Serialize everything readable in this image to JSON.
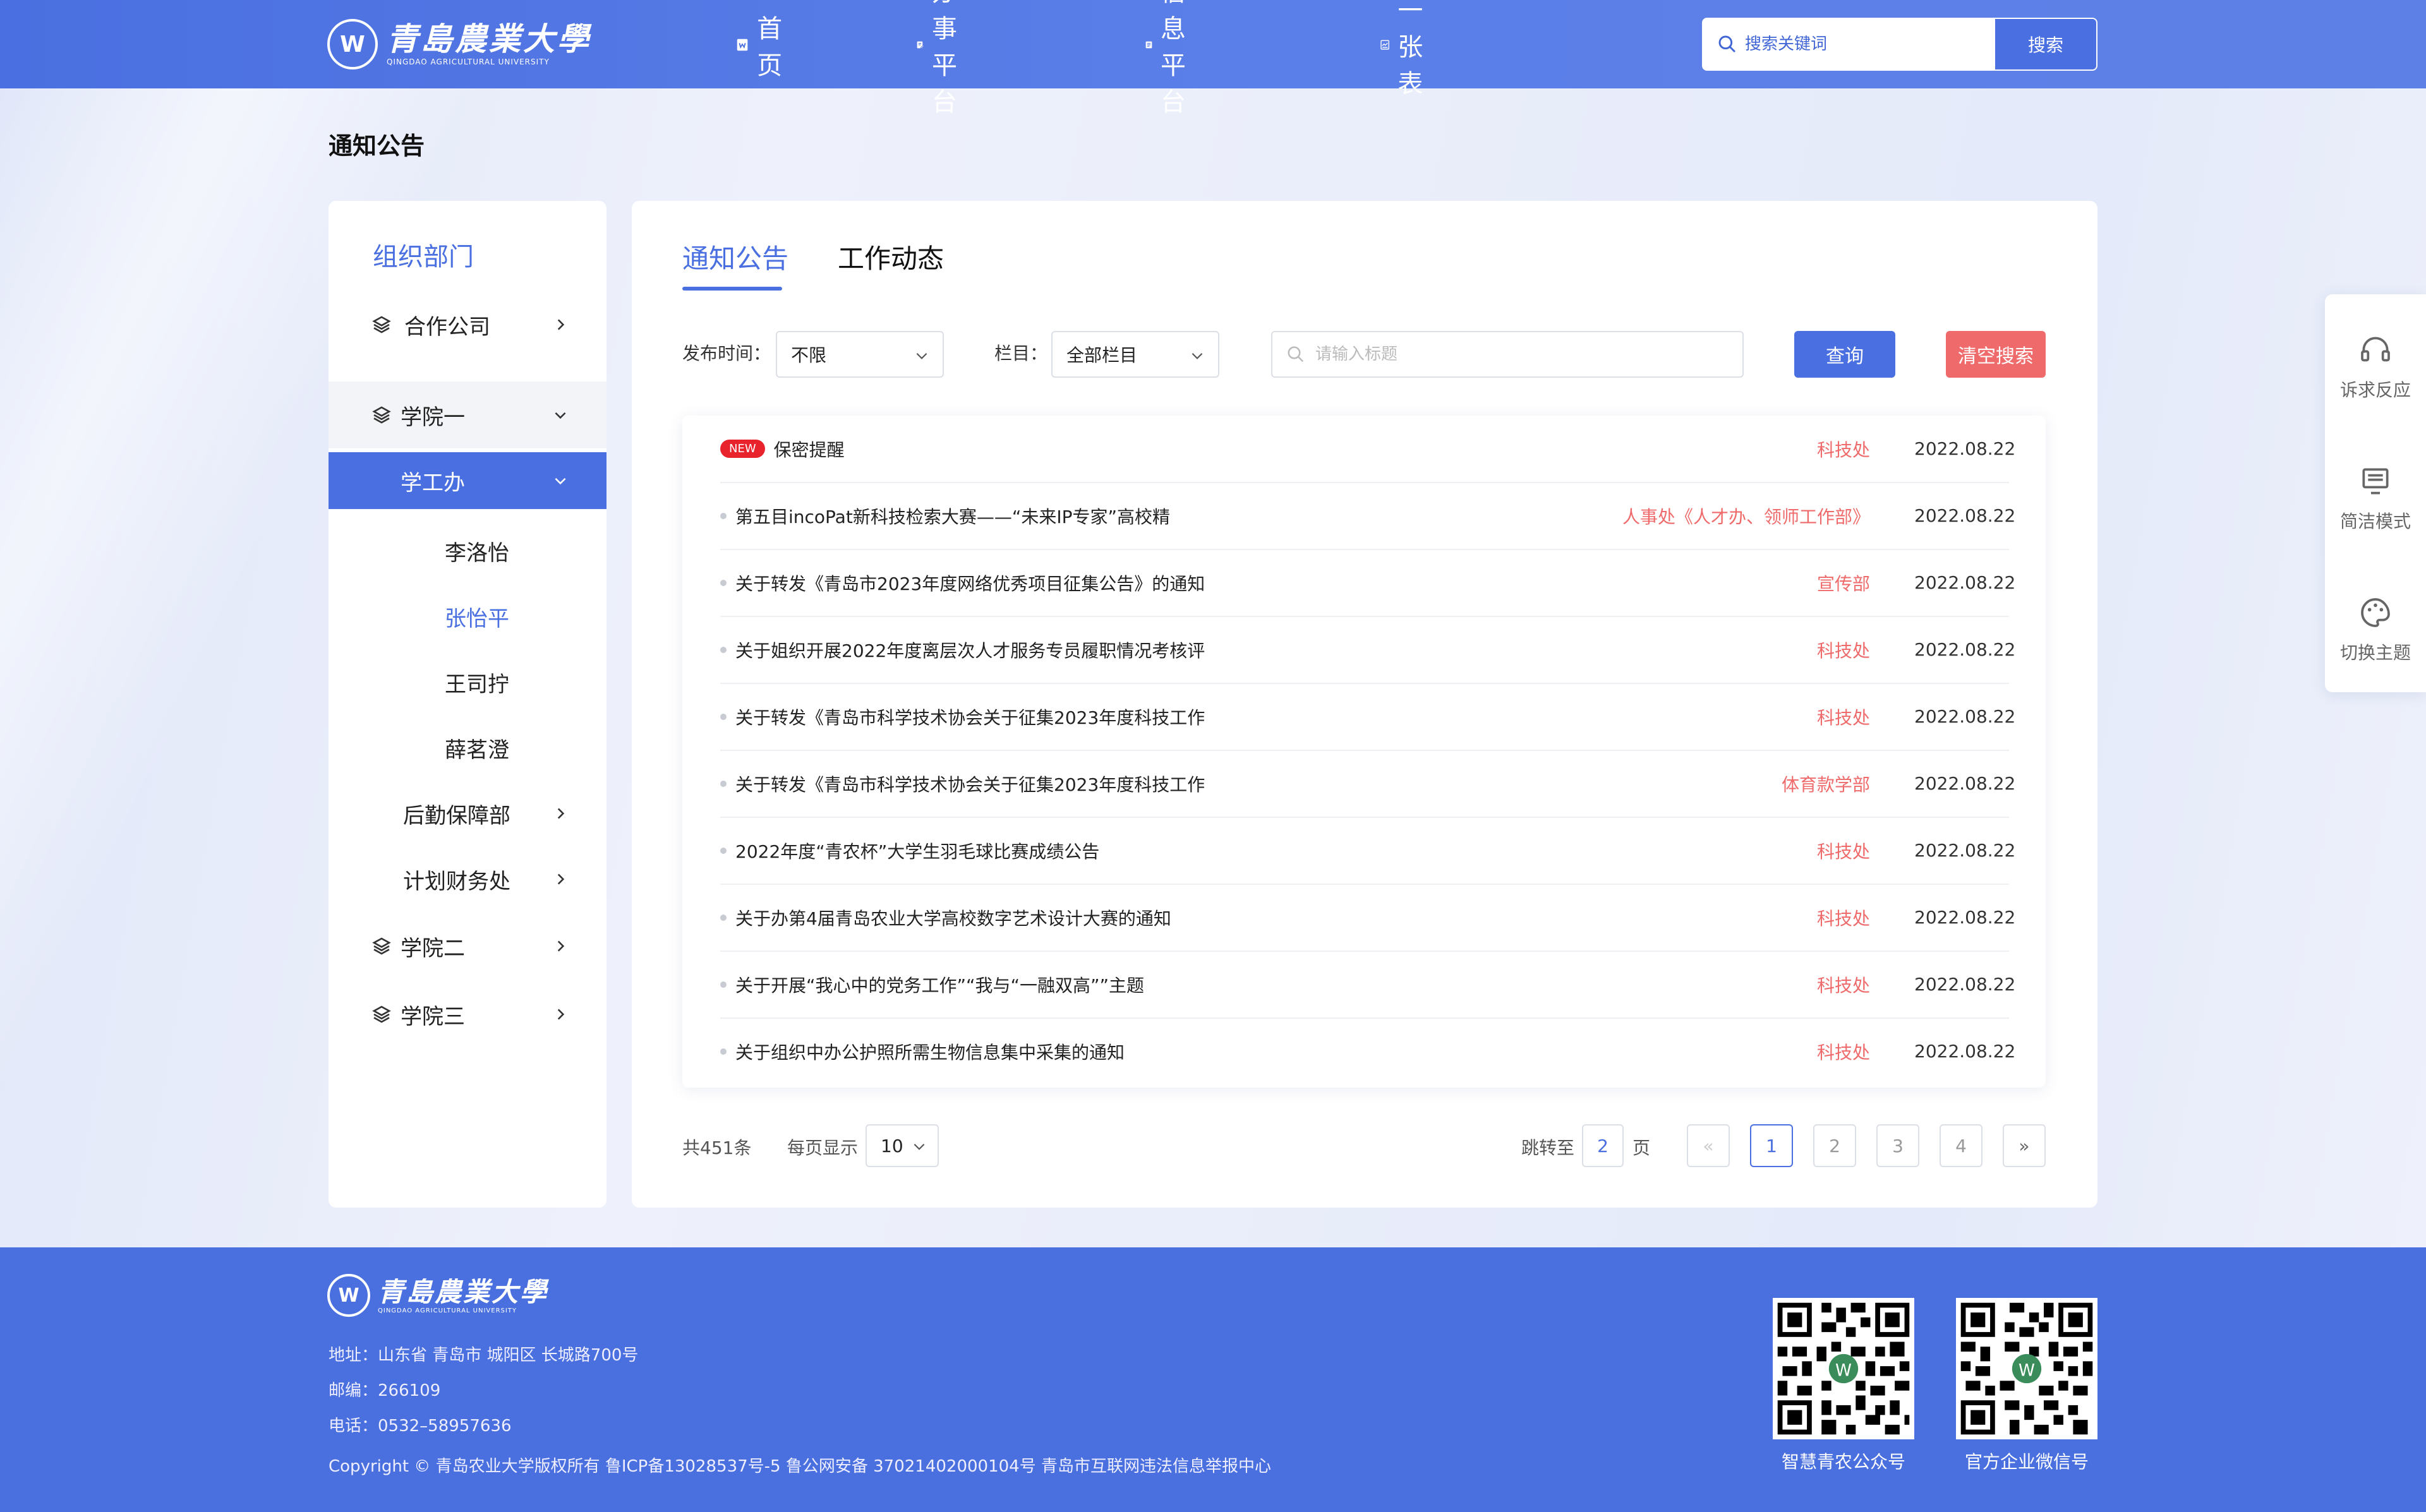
{
  "header": {
    "logo_cn": "青島農業大學",
    "logo_en": "QINGDAO AGRICULTURAL UNIVERSITY",
    "nav": [
      {
        "label": "首页",
        "icon": "home-doc-icon"
      },
      {
        "label": "办事平台",
        "icon": "edit-doc-icon"
      },
      {
        "label": "信息平台",
        "icon": "info-doc-icon"
      },
      {
        "label": "一张表",
        "icon": "chart-doc-icon"
      }
    ],
    "search_placeholder": "搜索关键词",
    "search_button": "搜索"
  },
  "page_title": "通知公告",
  "sidebar": {
    "heading": "组织部门",
    "items": [
      {
        "label": "合作公司"
      },
      {
        "label": "学院一"
      },
      {
        "label": "学工办"
      },
      {
        "label": "李洛怡"
      },
      {
        "label": "张怡平"
      },
      {
        "label": "王司拧"
      },
      {
        "label": "薛茗澄"
      },
      {
        "label": "后勤保障部"
      },
      {
        "label": "计划财务处"
      },
      {
        "label": "学院二"
      },
      {
        "label": "学院三"
      }
    ]
  },
  "tabs": [
    {
      "label": "通知公告",
      "active": true
    },
    {
      "label": "工作动态",
      "active": false
    }
  ],
  "filters": {
    "time_label": "发布时间：",
    "time_value": "不限",
    "column_label": "栏目：",
    "column_value": "全部栏目",
    "title_placeholder": "请输入标题",
    "query_button": "查询",
    "clear_button": "清空搜索"
  },
  "notices": [
    {
      "badge": "NEW",
      "title": "保密提醒",
      "dept": "科技处",
      "date": "2022.08.22"
    },
    {
      "title": "第五目incoPat新科技检索大赛——“未来IP专家”高校精",
      "dept": "人事处《人才办、领师工作部》",
      "date": "2022.08.22"
    },
    {
      "title": "关于转发《青岛市2023年度网络优秀项目征集公告》的通知",
      "dept": "宣传部",
      "date": "2022.08.22"
    },
    {
      "title": "关于姐织开展2022年度离层次人才服务专员履职情况考核评",
      "dept": "科技处",
      "date": "2022.08.22"
    },
    {
      "title": "关于转发《青岛市科学技术协会关于征集2023年度科技工作",
      "dept": "科技处",
      "date": "2022.08.22"
    },
    {
      "title": "关于转发《青岛市科学技术协会关于征集2023年度科技工作",
      "dept": "体育款学部",
      "date": "2022.08.22"
    },
    {
      "title": "2022年度“青农杯”大学生羽毛球比赛成绩公告",
      "dept": "科技处",
      "date": "2022.08.22"
    },
    {
      "title": "关于办第4届青岛农业大学高校数字艺术设计大赛的通知",
      "dept": "科技处",
      "date": "2022.08.22"
    },
    {
      "title": "关于开展“我心中的党务工作”“我与“一融双高””主题",
      "dept": "科技处",
      "date": "2022.08.22"
    },
    {
      "title": "关于组织中办公护照所需生物信息集中采集的通知",
      "dept": "科技处",
      "date": "2022.08.22"
    }
  ],
  "pagination": {
    "total": "共451条",
    "per_page_label": "每页显示",
    "per_page_value": "10",
    "jump_label": "跳转至",
    "jump_value": "2",
    "jump_unit": "页",
    "first": "«",
    "pages": [
      "1",
      "2",
      "3",
      "4"
    ],
    "current_page": "1",
    "last": "»"
  },
  "float_menu": [
    {
      "label": "诉求反应",
      "icon": "headset-icon"
    },
    {
      "label": "简洁模式",
      "icon": "monitor-icon"
    },
    {
      "label": "切换主题",
      "icon": "palette-icon"
    }
  ],
  "footer": {
    "logo_cn": "青島農業大學",
    "logo_en": "QINGDAO AGRICULTURAL UNIVERSITY",
    "address": "地址：山东省 青岛市 城阳区 长城路700号",
    "postcode": "邮编：266109",
    "phone": "电话：0532–58957636",
    "copyright": "Copyright © 青岛农业大学版权所有 鲁ICP备13028537号-5 鲁公网安备 37021402000104号 青岛市互联网违法信息举报中心",
    "qr1_label": "智慧青农公众号",
    "qr2_label": "官方企业微信号"
  },
  "colors": {
    "brand": "#4a6fe0",
    "danger": "#ef6a6a",
    "new_badge": "#e8232c"
  }
}
